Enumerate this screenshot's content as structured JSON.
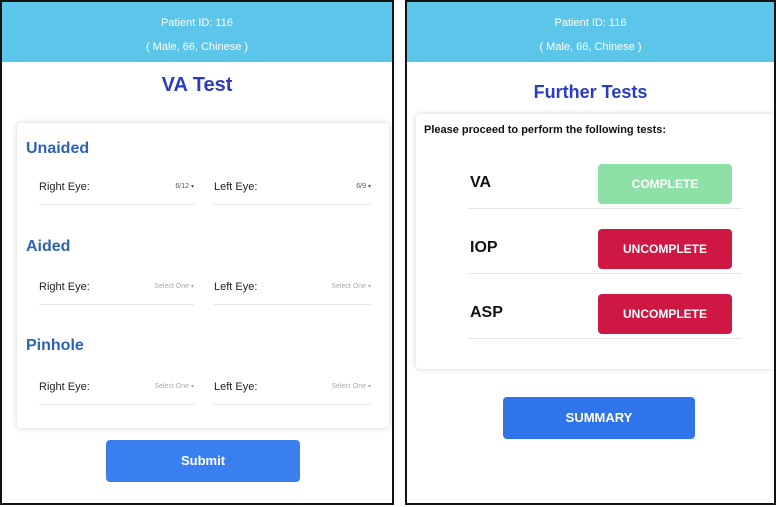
{
  "patient": {
    "id_text": "Patient ID: 116",
    "demographics": "( Male, 66, Chinese )"
  },
  "va_test": {
    "title": "VA Test",
    "right_eye_label": "Right Eye:",
    "left_eye_label": "Left Eye:",
    "sections": [
      {
        "name": "Unaided",
        "right_value": "6/12",
        "left_value": "6/9"
      },
      {
        "name": "Aided",
        "right_value": "Select One",
        "left_value": "Select One"
      },
      {
        "name": "Pinhole",
        "right_value": "Select One",
        "left_value": "Select One"
      }
    ],
    "submit_label": "Submit"
  },
  "further_tests": {
    "title": "Further Tests",
    "instruction": "Please proceed to perform the following tests:",
    "tests": [
      {
        "name": "VA",
        "status": "COMPLETE"
      },
      {
        "name": "IOP",
        "status": "UNCOMPLETE"
      },
      {
        "name": "ASP",
        "status": "UNCOMPLETE"
      }
    ],
    "summary_label": "SUMMARY"
  },
  "colors": {
    "header": "#5bc6ea",
    "title": "#2a3bc4",
    "section_title": "#2c63b5",
    "primary_button": "#3a7ff0",
    "complete": "#8de0a6",
    "uncomplete": "#cf1743"
  },
  "icons": {
    "dropdown": "caret-down-icon"
  }
}
